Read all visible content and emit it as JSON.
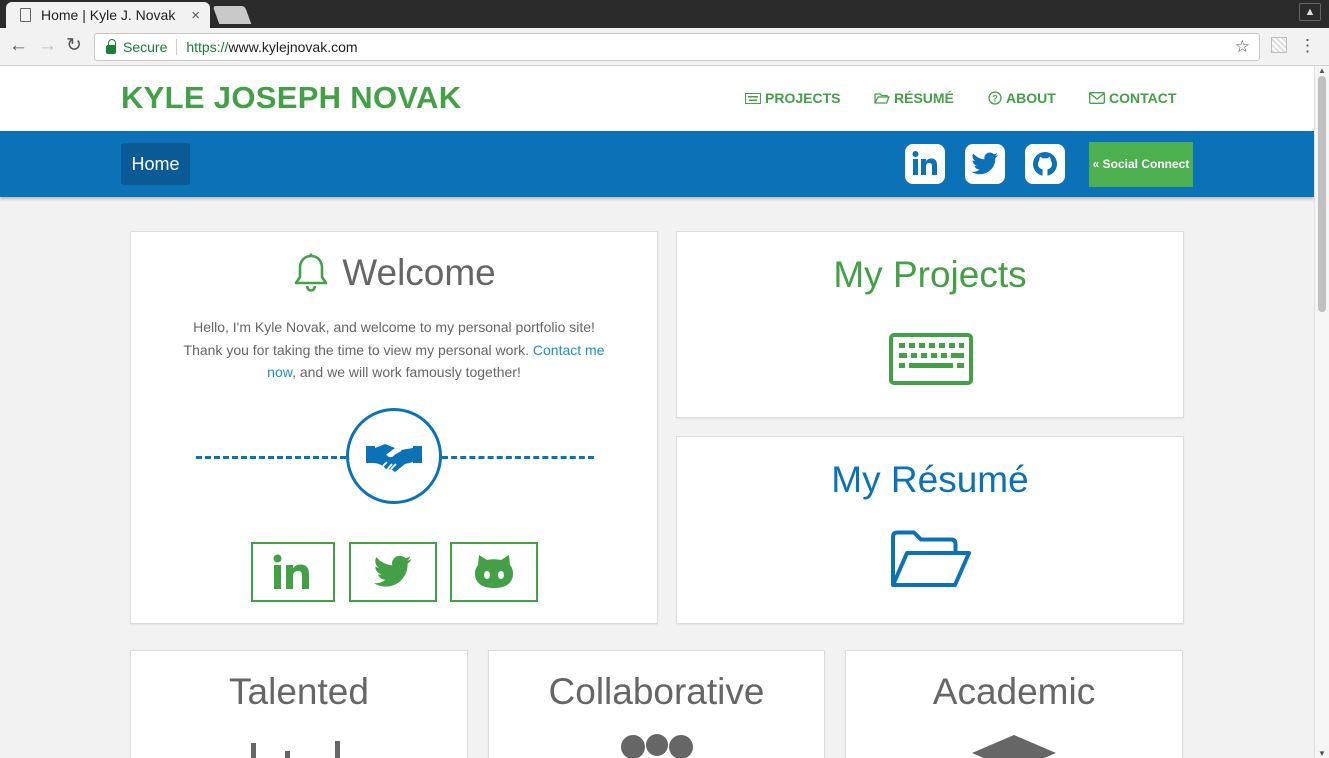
{
  "browser": {
    "tab_title": "Home | Kyle J. Novak",
    "tab_close": "×",
    "secure_label": "Secure",
    "url_scheme": "https://",
    "url_rest": "www.kylejnovak.com"
  },
  "site": {
    "title": "KYLE JOSEPH NOVAK",
    "nav": [
      {
        "icon": "keyboard-icon",
        "label": "PROJECTS"
      },
      {
        "icon": "folder-icon",
        "label": "RÉSUMÉ"
      },
      {
        "icon": "question-circle-icon",
        "label": "ABOUT"
      },
      {
        "icon": "envelope-icon",
        "label": "CONTACT"
      }
    ],
    "home_label": "Home",
    "social_connect_label": "« Social Connect",
    "social_icons": [
      "linkedin-icon",
      "twitter-icon",
      "github-icon"
    ]
  },
  "welcome": {
    "title": "Welcome",
    "text_before_link": "Hello, I'm Kyle Novak, and welcome to my personal portfolio site! Thank you for taking the time to view my personal work.",
    "link_text": "Contact me now",
    "text_after_link": ", and we will work famously together!"
  },
  "projects_card": {
    "title": "My Projects"
  },
  "resume_card": {
    "title": "My Résumé"
  },
  "tiles": [
    {
      "title": "Talented"
    },
    {
      "title": "Collaborative"
    },
    {
      "title": "Academic"
    }
  ],
  "colors": {
    "brand_green": "#43a047",
    "brand_blue": "#0b72b8",
    "text_gray": "#666666"
  }
}
